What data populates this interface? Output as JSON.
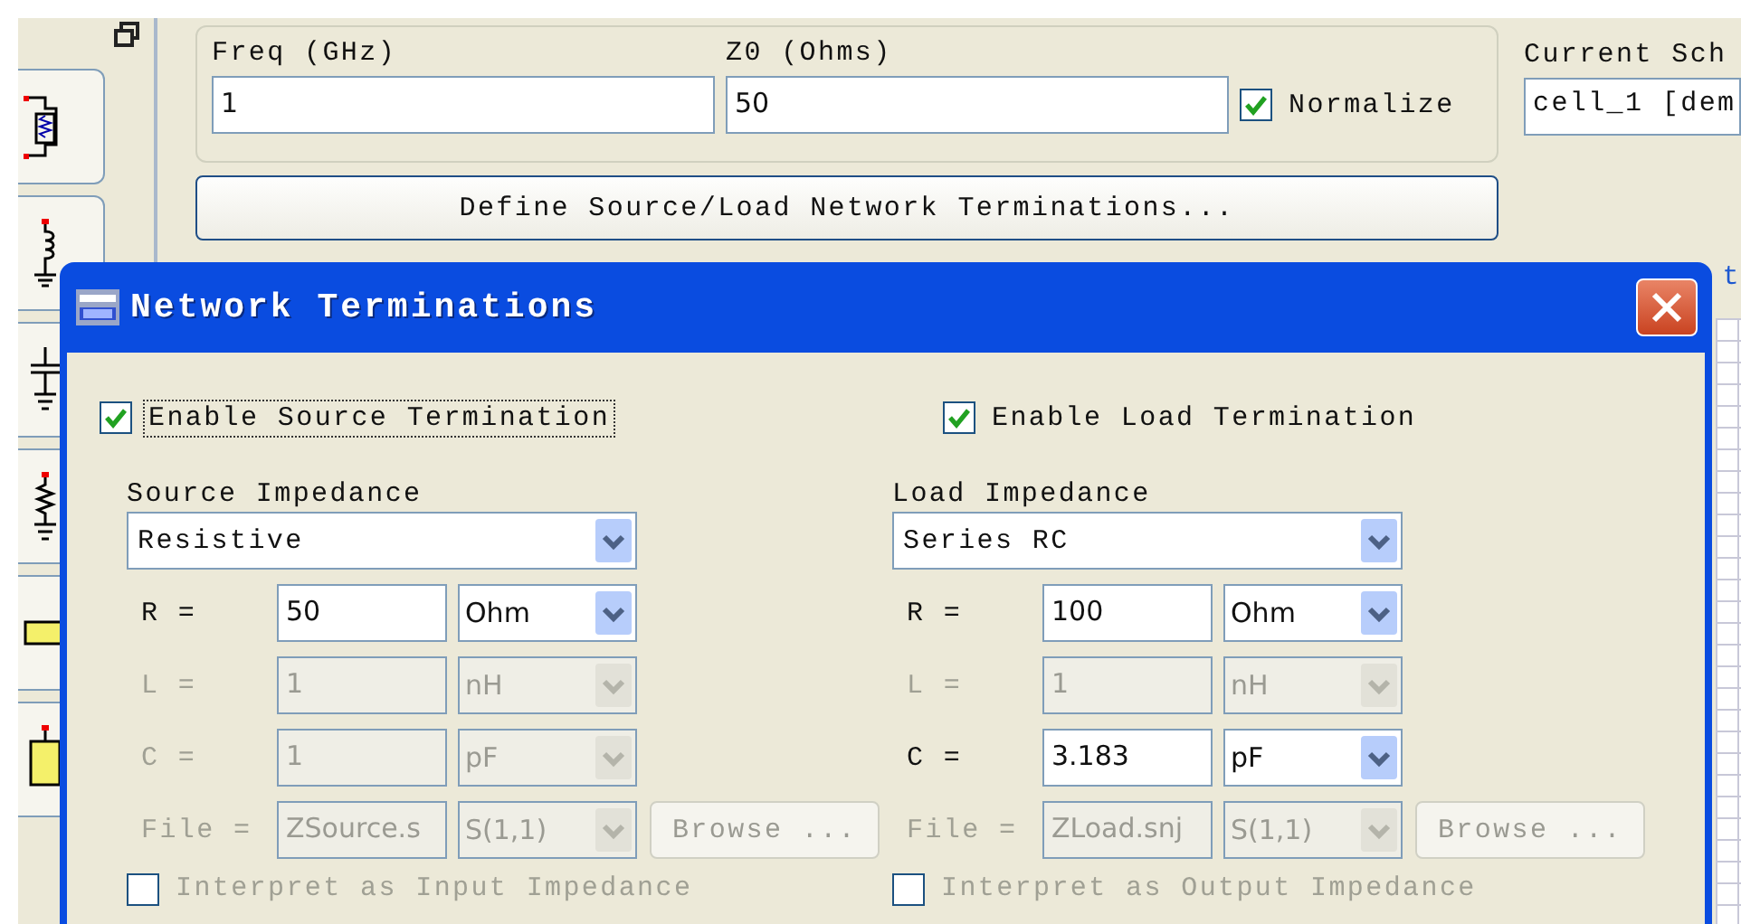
{
  "top_panel": {
    "freq": {
      "label": "Freq (GHz)",
      "value": "1"
    },
    "z0": {
      "label": "Z0 (Ohms)",
      "value": "50"
    },
    "normalize": {
      "label": "Normalize",
      "checked": true
    },
    "define_button": "Define Source/Load Network Terminations...",
    "schematic": {
      "label": "Current Sch",
      "value": "cell_1 [dem"
    }
  },
  "plot_title": "t",
  "dialog": {
    "title": "Network Terminations",
    "sides": [
      {
        "enable": {
          "label": "Enable Source Termination",
          "checked": true,
          "focused": true
        },
        "impedance_label": "Source Impedance",
        "type": "Resistive",
        "rows": [
          {
            "label": "R =",
            "value": "50",
            "unit": "Ohm",
            "disabled": false
          },
          {
            "label": "L =",
            "value": "1",
            "unit": "nH",
            "disabled": true
          },
          {
            "label": "C =",
            "value": "1",
            "unit": "pF",
            "disabled": true
          }
        ],
        "file": {
          "label": "File =",
          "value": "ZSource.s",
          "unit": "S(1,1)",
          "disabled": true,
          "browse": "Browse ..."
        },
        "interpret": {
          "label": "Interpret as Input Impedance",
          "checked": false
        }
      },
      {
        "enable": {
          "label": "Enable Load Termination",
          "checked": true,
          "focused": false
        },
        "impedance_label": "Load Impedance",
        "type": "Series RC",
        "rows": [
          {
            "label": "R =",
            "value": "100",
            "unit": "Ohm",
            "disabled": false
          },
          {
            "label": "L =",
            "value": "1",
            "unit": "nH",
            "disabled": true
          },
          {
            "label": "C =",
            "value": "3.183",
            "unit": "pF",
            "disabled": false
          }
        ],
        "file": {
          "label": "File =",
          "value": "ZLoad.snj",
          "unit": "S(1,1)",
          "disabled": true,
          "browse": "Browse ..."
        },
        "interpret": {
          "label": "Interpret as Output Impedance",
          "checked": false
        }
      }
    ]
  }
}
